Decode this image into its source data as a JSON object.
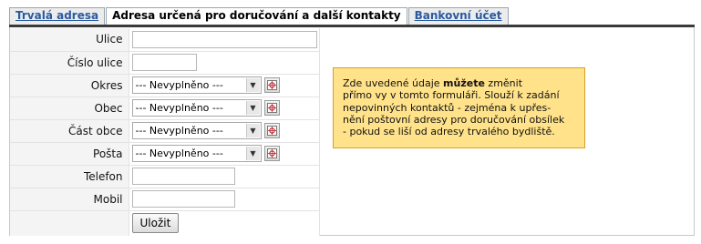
{
  "tabs": [
    {
      "label": "Trvalá adresa",
      "active": false
    },
    {
      "label": "Adresa určená pro doručování a další kontakty",
      "active": true
    },
    {
      "label": "Bankovní účet",
      "active": false
    }
  ],
  "form": {
    "fields": {
      "ulice": {
        "label": "Ulice",
        "value": ""
      },
      "cislo_ulice": {
        "label": "Číslo ulice",
        "value": ""
      },
      "okres": {
        "label": "Okres",
        "value": "--- Nevyplněno ---"
      },
      "obec": {
        "label": "Obec",
        "value": "--- Nevyplněno ---"
      },
      "cast_obce": {
        "label": "Část obce",
        "value": "--- Nevyplněno ---"
      },
      "posta": {
        "label": "Pošta",
        "value": "--- Nevyplněno ---"
      },
      "telefon": {
        "label": "Telefon",
        "value": ""
      },
      "mobil": {
        "label": "Mobil",
        "value": ""
      }
    },
    "save_label": "Uložit"
  },
  "info": {
    "line1_a": "Zde uvedené údaje ",
    "line1_bold": "můžete",
    "line1_b": " změnit",
    "line2": "přímo vy v tomto formuláři. Slouží k zadání",
    "line3": "nepovinných kontaktů - zejména k upřes-",
    "line4": "nění poštovní adresy pro doručování obsílek",
    "line5": "- pokud se liší od adresy trvalého bydliště."
  },
  "icons": {
    "select_arrow": "chevron-down-icon",
    "picker": "picker-icon"
  },
  "colors": {
    "tab_link": "#2a5aa0",
    "info_bg": "#ffe28a",
    "info_border": "#d4a02a",
    "label_bg": "#f4f4f4"
  }
}
